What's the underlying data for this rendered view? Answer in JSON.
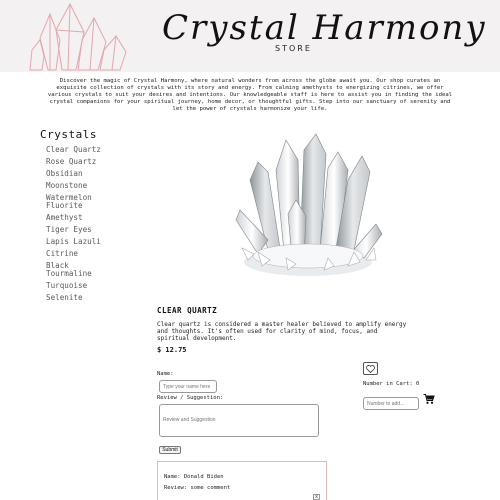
{
  "header": {
    "brand_title": "Crystal Harmony",
    "brand_subtitle": "STORE",
    "logo_icon": "crystal-cluster-outline-icon",
    "logo_color": "#e4a7ad"
  },
  "intro": {
    "text": "Discover the magic of Crystal Harmony, where natural wonders from across the globe await you. Our shop curates an exquisite collection of crystals with its story and energy. From calming amethysts to energizing citrines, we offer various crystals to suit your desires and intentions. Our knowledgeable staff is here to assist you in finding the ideal crystal companions for your spiritual journey, home decor, or thoughtful gifts. Step into our sanctuary of serenity and let the power of crystals harmonize your life."
  },
  "sidebar": {
    "title": "Crystals",
    "items": [
      {
        "label": "Clear Quartz"
      },
      {
        "label": "Rose Quartz"
      },
      {
        "label": "Obsidian"
      },
      {
        "label": "Moonstone"
      },
      {
        "label": "Watermelon Fluorite"
      },
      {
        "label": "Amethyst"
      },
      {
        "label": "Tiger Eyes"
      },
      {
        "label": "Lapis Lazuli"
      },
      {
        "label": "Citrine"
      },
      {
        "label": "Black Tourmaline"
      },
      {
        "label": "Turquoise"
      },
      {
        "label": "Selenite"
      }
    ]
  },
  "product": {
    "name": "CLEAR QUARTZ",
    "description": "Clear quartz is considered a master healer believed to amplify energy and thoughts. It's often used for clarity of mind, focus, and spiritual development.",
    "price": "$ 12.75",
    "image_icon": "clear-quartz-cluster"
  },
  "review_form": {
    "name_label": "Name:",
    "name_placeholder": "Type your name here",
    "review_label": "Review / Suggestion:",
    "review_placeholder": "Review and Suggestion",
    "submit_label": "Submit"
  },
  "submitted_review": {
    "name_line": "Name: Donald Biden",
    "review_line": "Review: some comment",
    "close_label": "x"
  },
  "cart": {
    "heart_icon": "heart-outline-icon",
    "count_text": "Number in Cart: 0",
    "add_placeholder": "Number to add...",
    "cart_icon": "shopping-cart-icon"
  }
}
